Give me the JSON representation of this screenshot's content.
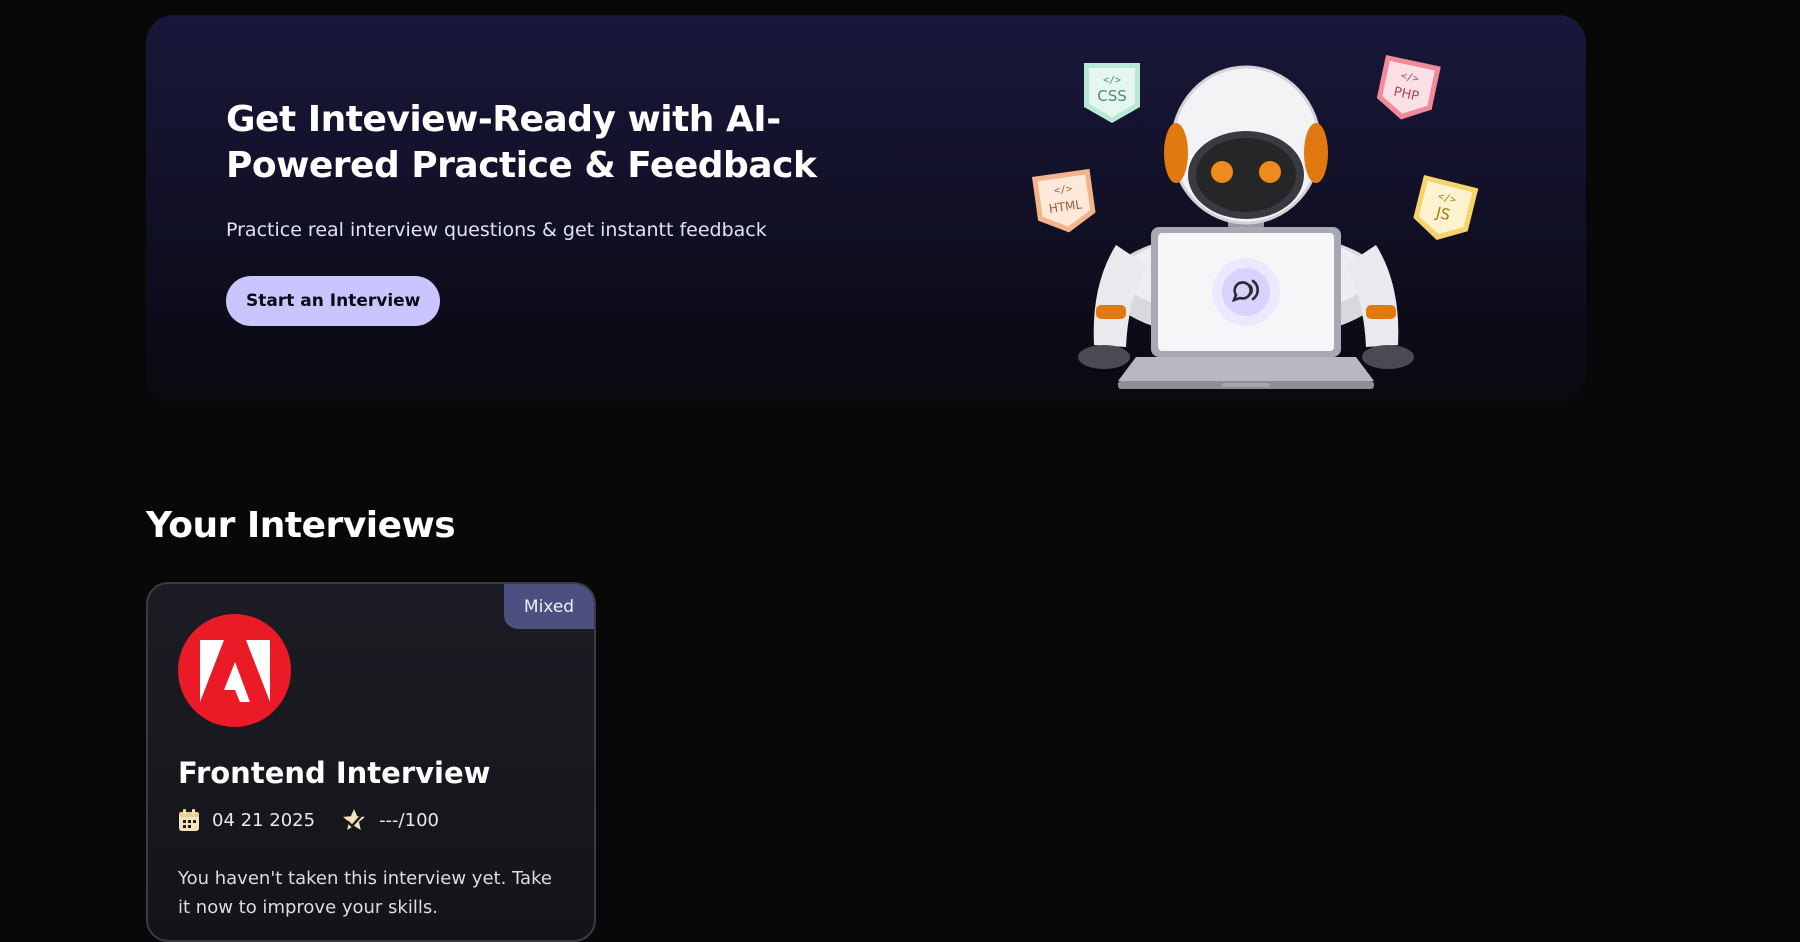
{
  "hero": {
    "title": "Get Inteview-Ready with AI-Powered Practice & Feedback",
    "subtitle": "Practice real interview questions & get instantt feedback",
    "cta_label": "Start an Interview",
    "tags": [
      "CSS",
      "PHP",
      "HTML",
      "JS"
    ]
  },
  "interviews": {
    "heading": "Your Interviews",
    "cards": [
      {
        "badge": "Mixed",
        "title": "Frontend Interview",
        "date": "04 21 2025",
        "score": "---/100",
        "description": "You haven't taken this interview yet. Take it now to improve your skills."
      }
    ]
  },
  "colors": {
    "accent": "#cac4ff",
    "badge_bg": "#4c5080",
    "logo_red": "#ea1a26"
  }
}
